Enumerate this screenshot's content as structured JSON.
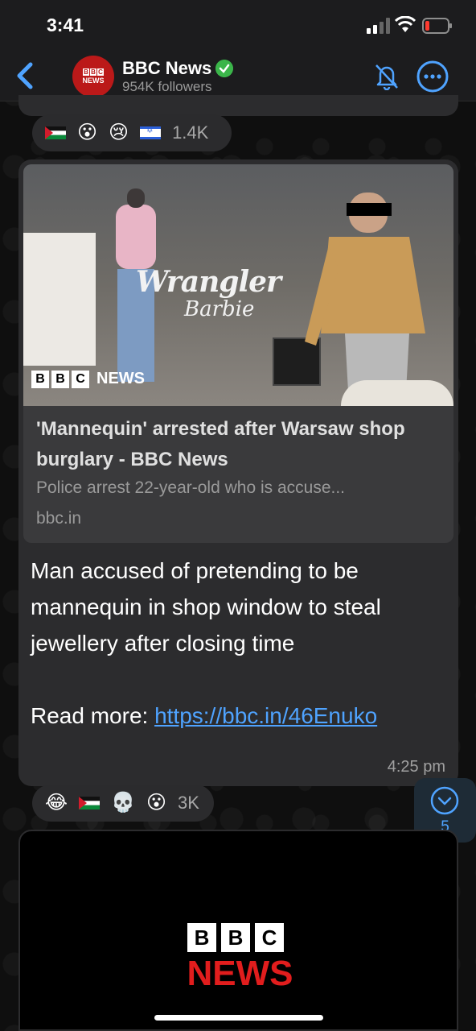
{
  "status": {
    "time": "3:41"
  },
  "header": {
    "channel_name": "BBC News",
    "followers": "954K followers",
    "avatar_text": {
      "blocks": [
        "B",
        "B",
        "C"
      ],
      "label": "NEWS"
    }
  },
  "reactions_top": {
    "emojis": [
      "🇵🇸",
      "😮",
      "😢",
      "🇮🇱"
    ],
    "count": "1.4K"
  },
  "message": {
    "preview": {
      "image_logo": {
        "blocks": [
          "B",
          "B",
          "C"
        ],
        "label": "NEWS"
      },
      "image_signage": [
        "Wrangler",
        "Barbie"
      ],
      "title": "'Mannequin' arrested after Warsaw shop burglary - BBC News",
      "description": "Police arrest 22-year-old who is accuse...",
      "domain": "bbc.in"
    },
    "text": "Man accused of pretending to be mannequin in shop window to steal jewellery after closing time",
    "read_more_label": "Read more: ",
    "link": "https://bbc.in/46Enuko",
    "time": "4:25 pm"
  },
  "reactions_bottom": {
    "emojis": [
      "😂",
      "🇵🇸",
      "💀",
      "😮"
    ],
    "count": "3K"
  },
  "scroll_down": {
    "unread_count": "5"
  },
  "video": {
    "blocks": [
      "B",
      "B",
      "C"
    ],
    "label": "NEWS"
  },
  "colors": {
    "accent": "#4fa3ff",
    "bbc_red": "#bb1919",
    "bubble": "#2c2c2e"
  }
}
